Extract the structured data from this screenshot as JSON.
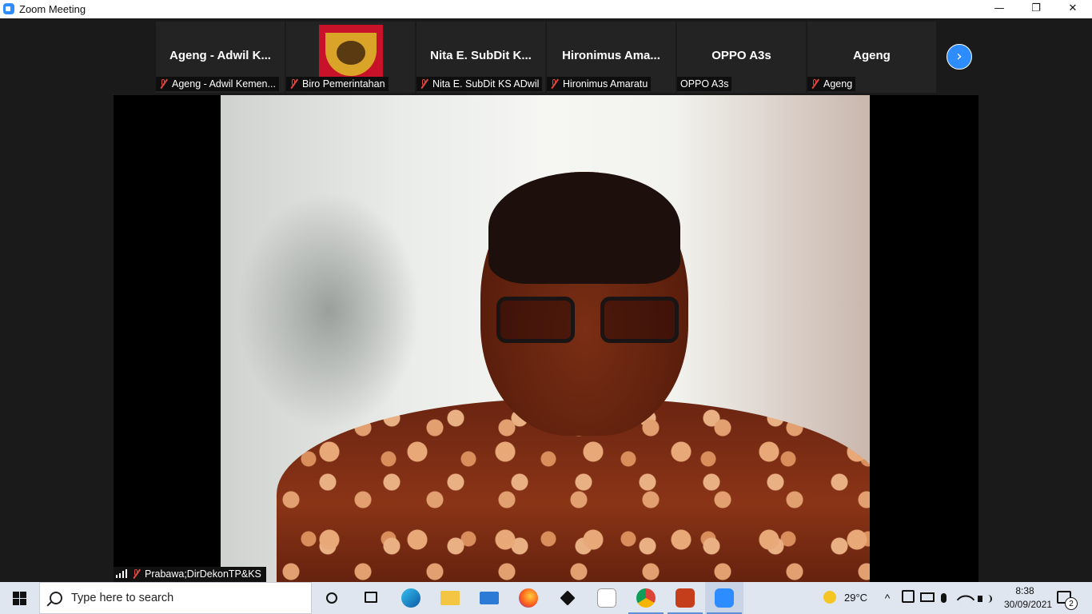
{
  "window": {
    "title": "Zoom Meeting",
    "minimize_glyph": "—",
    "restore_glyph": "❐",
    "close_glyph": "✕"
  },
  "thumbnails": [
    {
      "big_name": "Ageng - Adwil K...",
      "label": "Ageng - Adwil Kemen...",
      "muted": true
    },
    {
      "big_name": "",
      "label": "Biro Pemerintahan",
      "muted": true,
      "has_logo": true
    },
    {
      "big_name": "Nita E. SubDit K...",
      "label": "Nita E. SubDit KS ADwil",
      "muted": true
    },
    {
      "big_name": "Hironimus  Ama...",
      "label": "Hironimus Amaratu",
      "muted": true
    },
    {
      "big_name": "OPPO A3s",
      "label": "OPPO A3s",
      "muted": false
    },
    {
      "big_name": "Ageng",
      "label": "Ageng",
      "muted": true
    }
  ],
  "next_page_glyph": "›",
  "active_speaker": {
    "name": "Prabawa;DirDekonTP&KS"
  },
  "taskbar": {
    "search_placeholder": "Type here to search",
    "weather_temp": "29°C",
    "time": "8:38",
    "date": "30/09/2021",
    "notification_count": "2",
    "tray_up_glyph": "^"
  },
  "colors": {
    "accent": "#2d8cff",
    "muted_icon": "#e0463d"
  }
}
